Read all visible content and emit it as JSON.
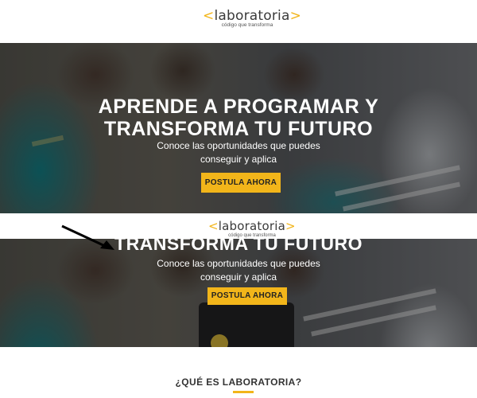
{
  "brand": {
    "name": "laboratoria",
    "bracket_left": "<",
    "bracket_right": ">",
    "tagline": "código que transforma"
  },
  "hero": {
    "title_line1": "APRENDE A PROGRAMAR  Y",
    "title_line2": "TRANSFORMA TU FUTURO",
    "subtitle_line1": "Conoce las oportunidades que puedes",
    "subtitle_line2": "conseguir y aplica",
    "cta_label": "POSTULA AHORA"
  },
  "section": {
    "title": "¿QUÉ ES LABORATORIA?"
  },
  "colors": {
    "accent": "#f2b51a",
    "text": "#333333",
    "overlay": "#1a1a1a"
  },
  "icons": [
    "arrow-pointer-icon"
  ]
}
